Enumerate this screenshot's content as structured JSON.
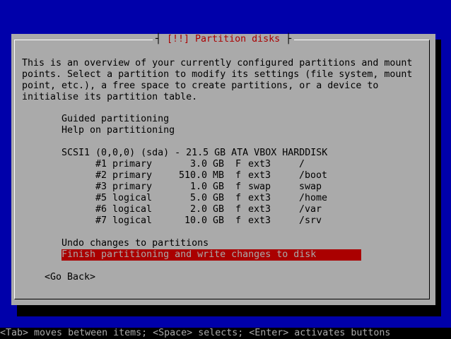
{
  "dialog": {
    "title": "[!!] Partition disks",
    "intro_lines": [
      "This is an overview of your currently configured partitions and mount",
      "points. Select a partition to modify its settings (file system, mount",
      "point, etc.), a free space to create partitions, or a device to",
      "initialise its partition table."
    ]
  },
  "menu": {
    "guided": "Guided partitioning",
    "help": "Help on partitioning",
    "disk": "SCSI1 (0,0,0) (sda) - 21.5 GB ATA VBOX HARDDISK",
    "partitions": [
      {
        "num": "#1",
        "kind": "primary",
        "size": "3.0 GB",
        "flag": "F",
        "fs": "ext3",
        "mount": "/"
      },
      {
        "num": "#2",
        "kind": "primary",
        "size": "510.0 MB",
        "flag": "f",
        "fs": "ext3",
        "mount": "/boot"
      },
      {
        "num": "#3",
        "kind": "primary",
        "size": "1.0 GB",
        "flag": "f",
        "fs": "swap",
        "mount": "swap"
      },
      {
        "num": "#5",
        "kind": "logical",
        "size": "5.0 GB",
        "flag": "f",
        "fs": "ext3",
        "mount": "/home"
      },
      {
        "num": "#6",
        "kind": "logical",
        "size": "2.0 GB",
        "flag": "f",
        "fs": "ext3",
        "mount": "/var"
      },
      {
        "num": "#7",
        "kind": "logical",
        "size": "10.0 GB",
        "flag": "f",
        "fs": "ext3",
        "mount": "/srv"
      }
    ],
    "undo": "Undo changes to partitions",
    "finish": "Finish partitioning and write changes to disk"
  },
  "buttons": {
    "go_back": "<Go Back>"
  },
  "statusbar": {
    "text": "<Tab> moves between items; <Space> selects; <Enter> activates buttons"
  },
  "colors": {
    "background": "#0000aa",
    "dialog": "#aaaaaa",
    "highlight": "#aa0000"
  }
}
